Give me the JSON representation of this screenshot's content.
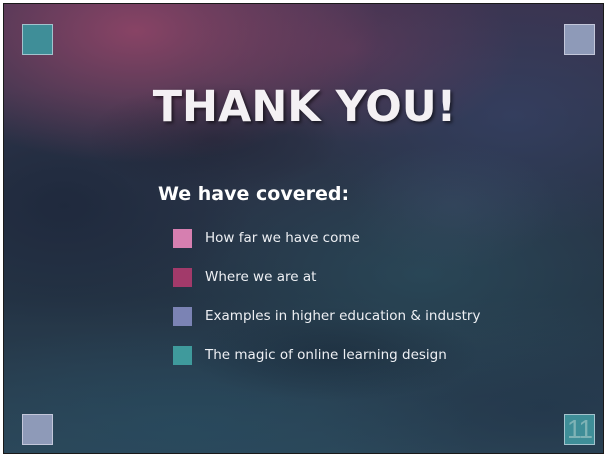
{
  "slide": {
    "title": "THANK YOU!",
    "subtitle": "We have covered:",
    "page_number": "11",
    "corner_colors": {
      "top_left": "#3f8e98",
      "top_right": "#8e9ab8",
      "bottom_left": "#8e9ab8",
      "bottom_right": "#3f8e98"
    },
    "bullets": [
      {
        "label": "How far we have come",
        "color": "#d67fb0"
      },
      {
        "label": "Where we are at",
        "color": "#a23a6a"
      },
      {
        "label": "Examples in higher education & industry",
        "color": "#7b83b4"
      },
      {
        "label": "The magic of online learning design",
        "color": "#3f9a9c"
      }
    ]
  }
}
